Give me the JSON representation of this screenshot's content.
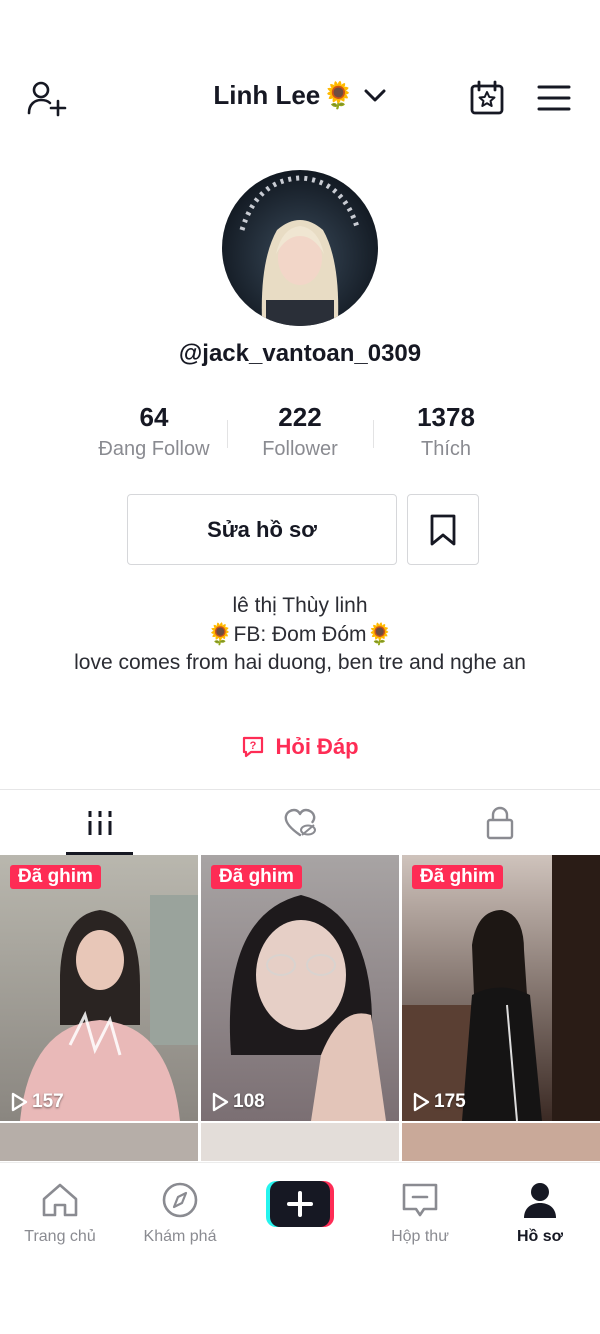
{
  "header": {
    "title": "Linh Lee",
    "title_emoji": "🌻",
    "add_friend_icon": "person-add-icon",
    "calendar_icon": "calendar-star-icon",
    "menu_icon": "hamburger-menu-icon"
  },
  "profile": {
    "username": "@jack_vantoan_0309",
    "stats": [
      {
        "value": "64",
        "label": "Đang Follow"
      },
      {
        "value": "222",
        "label": "Follower"
      },
      {
        "value": "1378",
        "label": "Thích"
      }
    ],
    "edit_button": "Sửa hồ sơ",
    "bio_lines": [
      "lê thị Thùy linh",
      "🌻FB: Đom Đóm🌻",
      "love comes from hai duong, ben tre and nghe an"
    ],
    "qa_label": "Hỏi Đáp"
  },
  "tabs": [
    {
      "name": "videos",
      "icon": "grid-icon",
      "active": true
    },
    {
      "name": "liked",
      "icon": "heart-hidden-icon",
      "active": false
    },
    {
      "name": "private",
      "icon": "lock-icon",
      "active": false
    }
  ],
  "videos": [
    {
      "pinned_label": "Đã ghim",
      "plays": "157"
    },
    {
      "pinned_label": "Đã ghim",
      "plays": "108"
    },
    {
      "pinned_label": "Đã ghim",
      "plays": "175"
    }
  ],
  "bottom_nav": [
    {
      "label": "Trang chủ",
      "icon": "home-icon",
      "active": false
    },
    {
      "label": "Khám phá",
      "icon": "compass-icon",
      "active": false
    },
    {
      "label": "",
      "icon": "plus-icon",
      "active": false
    },
    {
      "label": "Hộp thư",
      "icon": "inbox-icon",
      "active": false
    },
    {
      "label": "Hồ sơ",
      "icon": "profile-icon",
      "active": true
    }
  ],
  "colors": {
    "accent": "#fe2c55",
    "text": "#161823",
    "secondary_text": "#8a8b91"
  }
}
